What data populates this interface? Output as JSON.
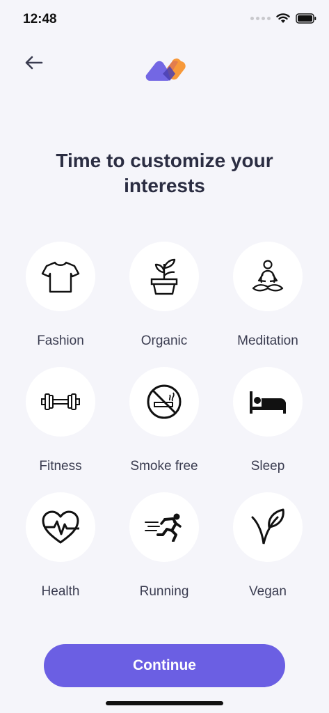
{
  "status_bar": {
    "time": "12:48"
  },
  "header": {
    "back_icon": "arrow-left-icon",
    "logo_icon": "brand-logo"
  },
  "title": "Time to customize your interests",
  "interests": [
    {
      "label": "Fashion",
      "icon": "tshirt-icon"
    },
    {
      "label": "Organic",
      "icon": "potted-plant-icon"
    },
    {
      "label": "Meditation",
      "icon": "meditation-icon"
    },
    {
      "label": "Fitness",
      "icon": "dumbbell-icon"
    },
    {
      "label": "Smoke free",
      "icon": "no-smoking-icon"
    },
    {
      "label": "Sleep",
      "icon": "bed-icon"
    },
    {
      "label": "Health",
      "icon": "heartbeat-icon"
    },
    {
      "label": "Running",
      "icon": "runner-icon"
    },
    {
      "label": "Vegan",
      "icon": "leaf-icon"
    }
  ],
  "continue_label": "Continue",
  "colors": {
    "accent": "#6b5fe3",
    "background": "#f5f5fa",
    "logo_orange": "#f7993a",
    "logo_purple": "#6b5fe3"
  }
}
